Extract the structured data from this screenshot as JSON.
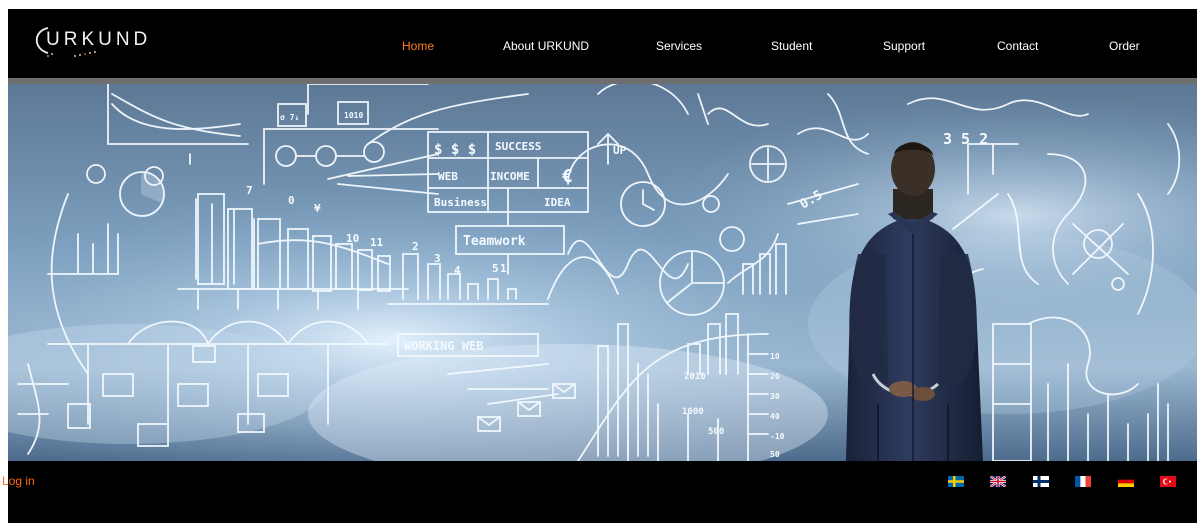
{
  "brand": {
    "name": "URKUND"
  },
  "nav": {
    "items": [
      {
        "label": "Home"
      },
      {
        "label": "About URKUND"
      },
      {
        "label": "Services"
      },
      {
        "label": "Student"
      },
      {
        "label": "Support"
      },
      {
        "label": "Contact"
      },
      {
        "label": "Order"
      }
    ],
    "active_color": "#ff7a1f",
    "text_color": "#ffffff"
  },
  "hero": {
    "labels": [
      "SUCCESS",
      "WEB",
      "INCOME",
      "€",
      "$ $ $",
      "Business",
      "IDEA",
      "Teamwork",
      "WORKING WEB",
      "UP",
      "2010",
      "1000",
      "500",
      "7",
      "10",
      "11",
      "2",
      "3",
      "4",
      "5",
      "¥",
      "0",
      "1",
      "3 5 2",
      "10",
      "20",
      "30",
      "40",
      "-10",
      "50",
      "0.5"
    ]
  },
  "footer": {
    "login_label": "Log in",
    "login_color": "#ff6a13",
    "languages": [
      {
        "name": "Swedish",
        "icon": "sweden-flag-icon"
      },
      {
        "name": "English",
        "icon": "uk-flag-icon"
      },
      {
        "name": "Finnish",
        "icon": "finland-flag-icon"
      },
      {
        "name": "French",
        "icon": "france-flag-icon"
      },
      {
        "name": "German",
        "icon": "germany-flag-icon"
      },
      {
        "name": "Turkish",
        "icon": "turkey-flag-icon"
      }
    ]
  }
}
